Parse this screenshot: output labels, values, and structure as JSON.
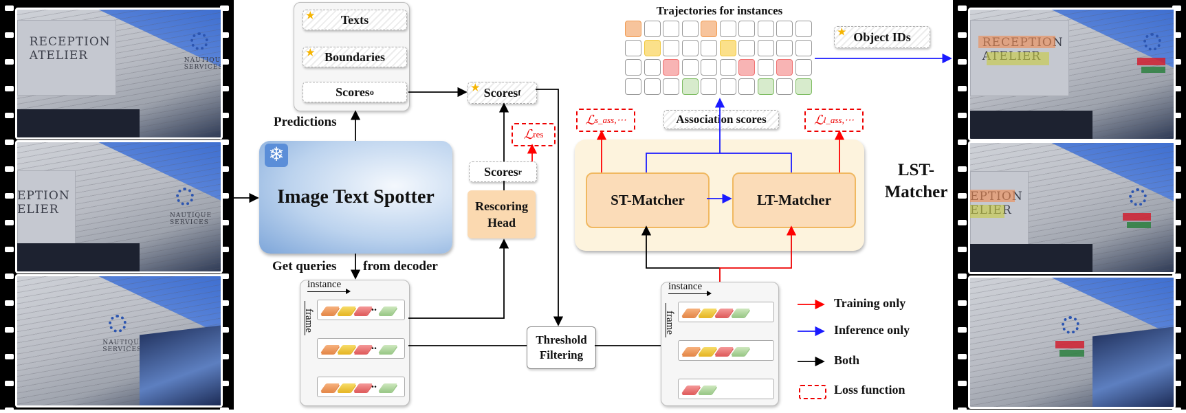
{
  "input_frames": {
    "frame1_text": [
      "RECEPTION",
      "ATELIER"
    ],
    "frame2_text": [
      "EPTION",
      "ELIER"
    ],
    "logo_text": [
      "NAUTIQUE",
      "SERVICES"
    ]
  },
  "predictions": {
    "label": "Predictions",
    "texts": "Texts",
    "boundaries": "Boundaries",
    "scores_o": {
      "base": "Scores",
      "sub": "o"
    }
  },
  "spotter": {
    "title": "Image Text Spotter",
    "frozen_icon": "snowflake-icon"
  },
  "get_queries": {
    "left": "Get queries",
    "right": "from decoder"
  },
  "scores_f": {
    "base": "Scores",
    "sub": "f"
  },
  "scores_r": {
    "base": "Scores",
    "sub": "r"
  },
  "rescoring_head": "Rescoring Head",
  "loss_res": {
    "symbol": "ℒ",
    "sub": "res"
  },
  "threshold": "Threshold Filtering",
  "query_box": {
    "instance": "instance",
    "frame": "frame",
    "ellipsis": ".."
  },
  "trajectories": {
    "title": "Trajectories for instances",
    "grid": [
      [
        "orange",
        "",
        "",
        "",
        "orange",
        "",
        "",
        "",
        "",
        ""
      ],
      [
        "",
        "yellow",
        "",
        "",
        "",
        "yellow",
        "",
        "",
        "",
        ""
      ],
      [
        "",
        "",
        "red",
        "",
        "",
        "",
        "red",
        "",
        "red",
        ""
      ],
      [
        "",
        "",
        "",
        "green",
        "",
        "",
        "",
        "green",
        "",
        "green"
      ]
    ]
  },
  "object_ids": "Object IDs",
  "association_scores": "Association scores",
  "loss_s": {
    "symbol": "ℒ",
    "sub": "s_ass",
    "tail": ",⋯"
  },
  "loss_l": {
    "symbol": "ℒ",
    "sub": "l_ass",
    "tail": ",⋯"
  },
  "lst": {
    "title_line1": "LST-",
    "title_line2": "Matcher",
    "st": "ST-Matcher",
    "lt": "LT-Matcher"
  },
  "legend": {
    "training": "Training only",
    "inference": "Inference only",
    "both": "Both",
    "loss": "Loss function"
  },
  "colors": {
    "training": "#ff0000",
    "inference": "#1a1aff",
    "both": "#000000",
    "orange": "#f7c49c",
    "yellow": "#fbe08a",
    "red": "#f8b4b4",
    "green": "#d7ebcc",
    "matcher_fill": "#fbdcb8",
    "lst_panel": "#fdf3dd"
  }
}
